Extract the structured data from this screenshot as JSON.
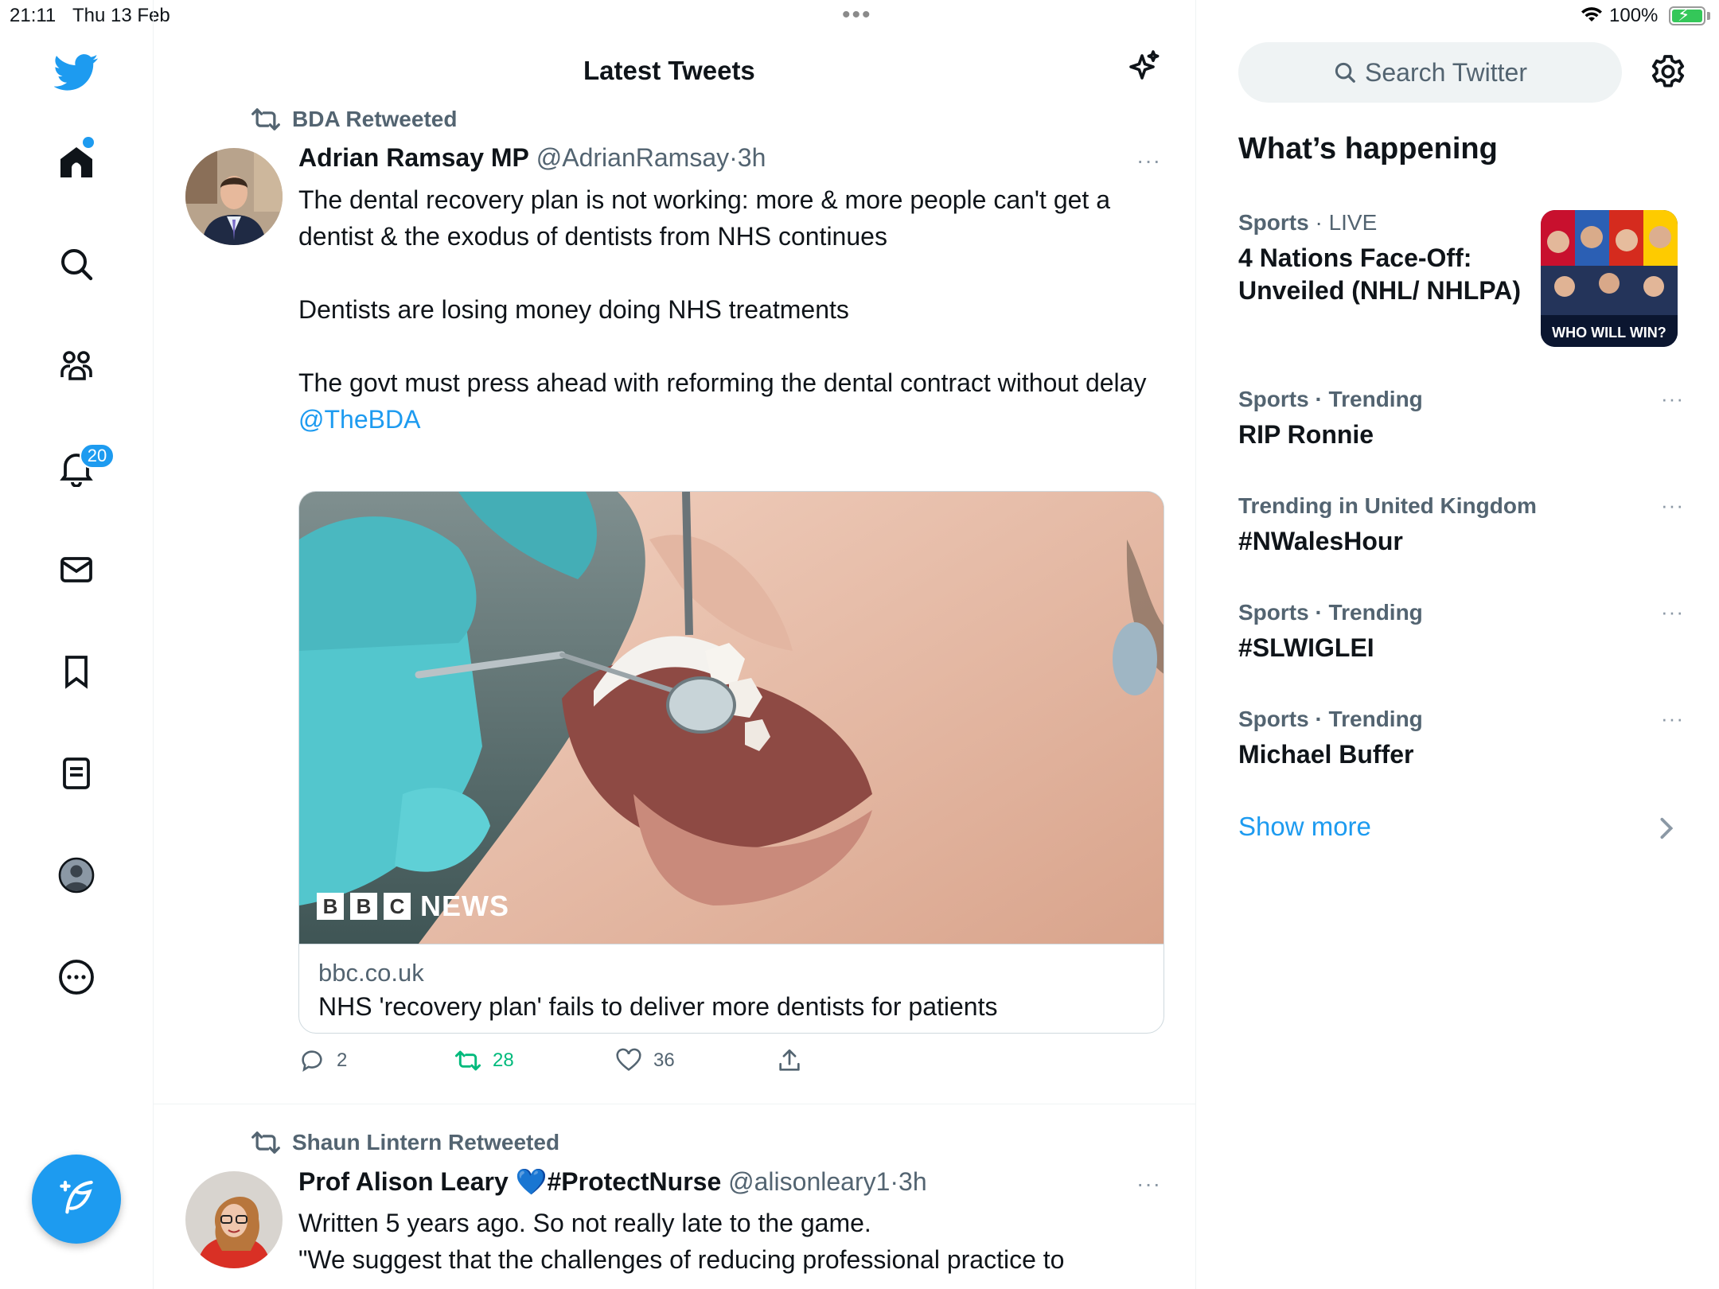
{
  "status_bar": {
    "time": "21:11",
    "date": "Thu 13 Feb",
    "battery": "100%",
    "multitask_dots": "•••"
  },
  "nav": {
    "notifications_badge": "20",
    "icons": [
      "twitter-bird-icon",
      "home-icon",
      "search-icon",
      "communities-icon",
      "notifications-icon",
      "messages-icon",
      "bookmarks-icon",
      "lists-icon",
      "profile-icon",
      "more-icon",
      "compose-icon"
    ],
    "accent_color": "#1d9bf0"
  },
  "main": {
    "title": "Latest Tweets",
    "tweets": [
      {
        "retweeted_by": "BDA Retweeted",
        "name": "Adrian Ramsay MP",
        "handle": "@AdrianRamsay",
        "sep": "·",
        "time": "3h",
        "more": "···",
        "body": [
          "The dental recovery plan is not working: more & more people can't get a dentist & the exodus of dentists from NHS continues",
          "Dentists are losing money doing NHS treatments",
          "The govt must press ahead with reforming the dental contract without delay"
        ],
        "mention": "@TheBDA",
        "card": {
          "image_logo_letters": [
            "B",
            "B",
            "C"
          ],
          "image_logo_word": "NEWS",
          "domain": "bbc.co.uk",
          "title": "NHS 'recovery plan' fails to deliver more dentists for patients"
        },
        "actions": {
          "replies": "2",
          "retweets": "28",
          "likes": "36"
        }
      },
      {
        "retweeted_by": "Shaun Lintern Retweeted",
        "name": "Prof Alison Leary",
        "name_emoji": "💙",
        "name_tag": "#ProtectNurse",
        "handle": "@alisonleary1",
        "sep": "·",
        "time": "3h",
        "more": "···",
        "body": [
          "Written 5 years ago. So not really late to the game.",
          "\"We suggest that the challenges of reducing professional practice to"
        ]
      }
    ]
  },
  "sidebar": {
    "search_placeholder": "Search Twitter",
    "section_title": "What’s happening",
    "trends": [
      {
        "category": "Sports",
        "sep": " · ",
        "status": "LIVE",
        "title": "4 Nations Face-Off: Unveiled (NHL/ NHLPA)",
        "image_text": "WHO WILL WIN?"
      },
      {
        "category": "Sports · Trending",
        "title": "RIP Ronnie",
        "more": "···"
      },
      {
        "category": "Trending in United Kingdom",
        "title": "#NWalesHour",
        "more": "···"
      },
      {
        "category": "Sports · Trending",
        "title": "#SLWIGLEI",
        "more": "···"
      },
      {
        "category": "Sports · Trending",
        "title": "Michael Buffer",
        "more": "···"
      }
    ],
    "show_more": "Show more"
  }
}
